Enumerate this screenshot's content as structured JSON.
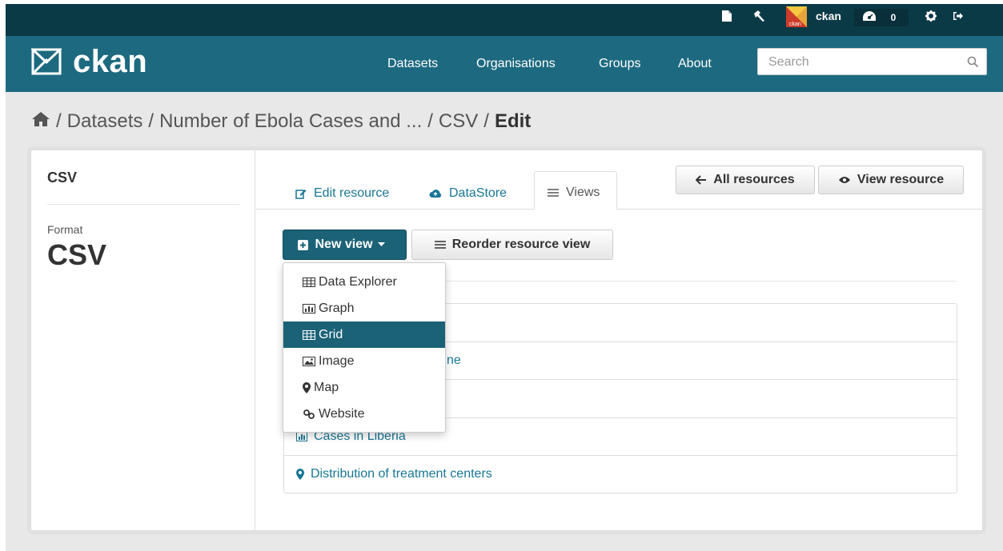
{
  "account": {
    "username": "ckan",
    "activity_count": "0",
    "avatar_text": "ckan"
  },
  "masthead": {
    "logo_text": "ckan",
    "nav": [
      "Datasets",
      "Organisations",
      "Groups",
      "About"
    ],
    "search_placeholder": "Search"
  },
  "breadcrumb": {
    "items": [
      "Datasets",
      "Number of Ebola Cases and ...",
      "CSV"
    ],
    "active": "Edit",
    "separator": "/"
  },
  "aside": {
    "title": "CSV",
    "format_label": "Format",
    "format_value": "CSV"
  },
  "tabs": [
    "Edit resource",
    "DataStore",
    "Views"
  ],
  "buttons": {
    "all_resources": "All resources",
    "view_resource": "View resource",
    "new_view": "New view",
    "reorder": "Reorder resource view"
  },
  "new_view_menu": {
    "items": [
      "Data Explorer",
      "Graph",
      "Grid",
      "Image",
      "Map",
      "Website"
    ],
    "selected": "Grid"
  },
  "views_list": {
    "items": [
      "",
      "ne",
      "",
      "Cases in Liberia",
      "Distribution of treatment centers"
    ]
  },
  "colors": {
    "account_bar": "#0b3a47",
    "masthead": "#1d6a80",
    "primary": "#1b6277",
    "link": "#187794"
  }
}
